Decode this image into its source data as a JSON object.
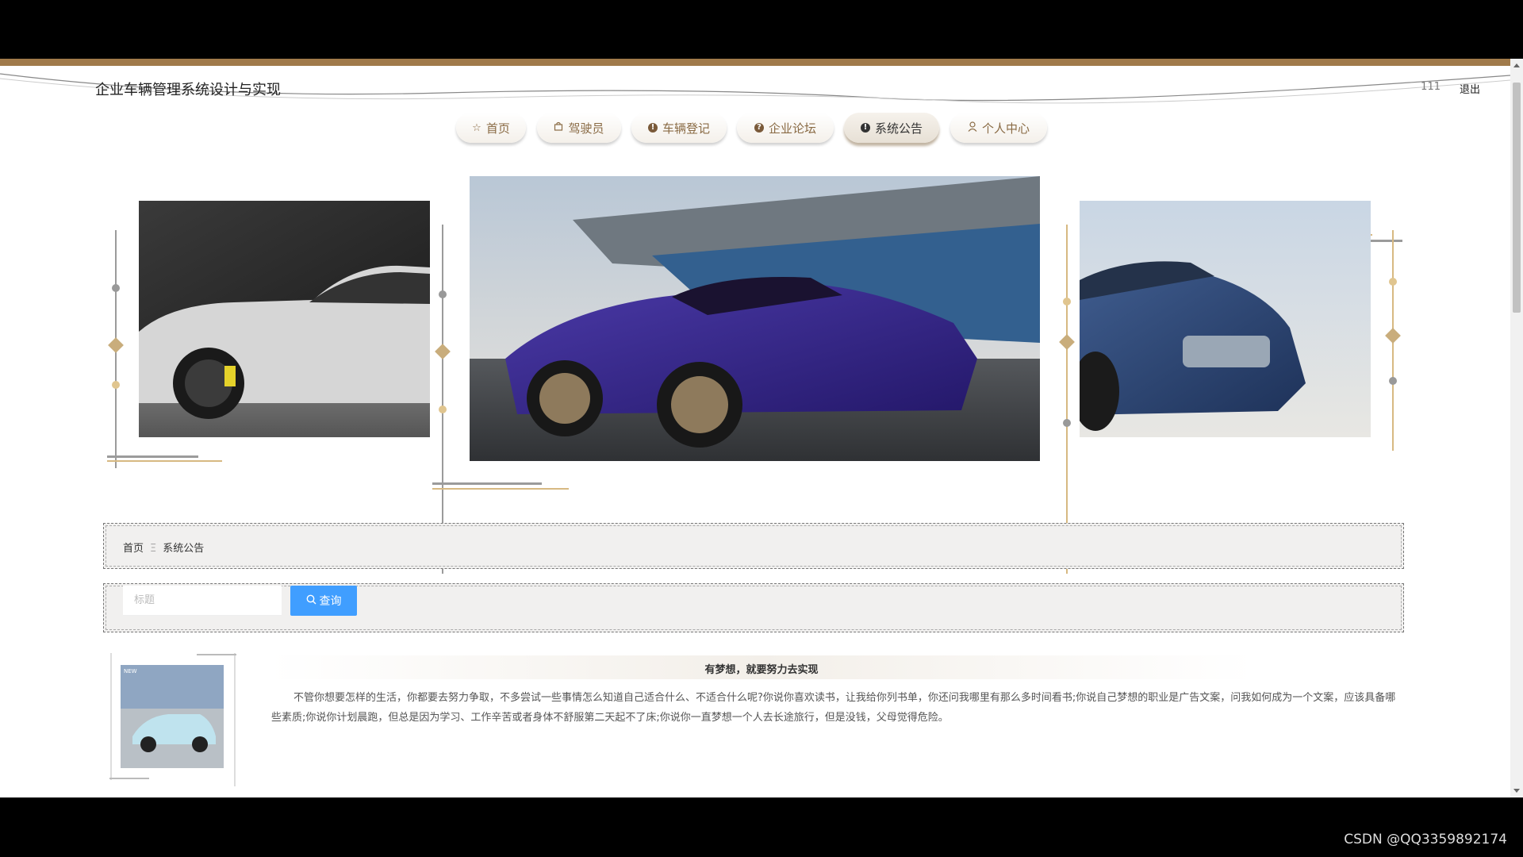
{
  "header": {
    "title": "企业车辆管理系统设计与实现",
    "user": "111",
    "logout_label": "退出"
  },
  "nav": {
    "items": [
      {
        "label": "首页",
        "icon": "star-icon"
      },
      {
        "label": "驾驶员",
        "icon": "bag-icon"
      },
      {
        "label": "车辆登记",
        "icon": "info-circle-icon"
      },
      {
        "label": "企业论坛",
        "icon": "question-circle-icon"
      },
      {
        "label": "系统公告",
        "icon": "info-circle-icon",
        "active": true
      },
      {
        "label": "个人中心",
        "icon": "user-icon"
      }
    ]
  },
  "carousel": {
    "slides": [
      {
        "subject": "white sports coupe",
        "color": "#c8c8c8"
      },
      {
        "subject": "purple supercar at race track",
        "color": "#3b2a8a"
      },
      {
        "subject": "blue luxury sedan",
        "color": "#2c4a78"
      }
    ],
    "active_index": 2,
    "count": 3
  },
  "breadcrumb": {
    "home": "首页",
    "separator": "Ξ",
    "current": "系统公告"
  },
  "search": {
    "placeholder": "标题",
    "value": "",
    "button_label": "查询"
  },
  "notices": [
    {
      "title": "有梦想，就要努力去实现",
      "content": "不管你想要怎样的生活，你都要去努力争取，不多尝试一些事情怎么知道自己适合什么、不适合什么呢?你说你喜欢读书，让我给你列书单，你还问我哪里有那么多时间看书;你说自己梦想的职业是广告文案，问我如何成为一个文案，应该具备哪些素质;你说你计划晨跑，但总是因为学习、工作辛苦或者身体不舒服第二天起不了床;你说你一直梦想一个人去长途旅行，但是没钱，父母觉得危险。",
      "thumb_badge": "NEW"
    }
  ],
  "watermark": "CSDN @QQ3359892174",
  "colors": {
    "accent_gold": "#a07a4a",
    "button_blue": "#409eff"
  }
}
